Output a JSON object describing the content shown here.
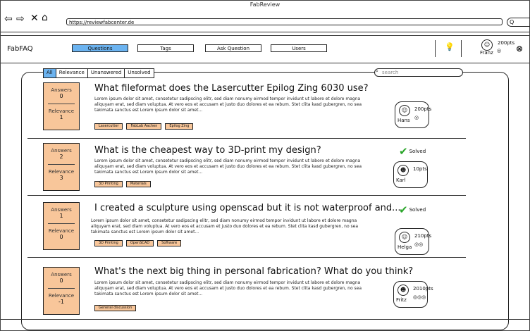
{
  "window": {
    "title": "FabReview"
  },
  "browser": {
    "url": "https://reviewfabcenter.de",
    "search_glyph": "Q"
  },
  "app": {
    "name": "FabFAQ",
    "tabs": [
      "Questions",
      "Tags",
      "Ask Question",
      "Users"
    ],
    "active_tab": "Questions",
    "user": {
      "name": "Franz",
      "points": "200pts",
      "badges": "◎"
    }
  },
  "filters": {
    "options": [
      "All",
      "Relevance",
      "Unanswered",
      "Unsolved"
    ],
    "selected": "All",
    "search_placeholder": "search"
  },
  "labels": {
    "answers": "Answers",
    "relevance": "Relevance",
    "solved": "Solved"
  },
  "questions": [
    {
      "title": "What fileformat does the Lasercutter Epilog Zing 6030 use?",
      "body": "Lorem ipsum dolor sit amet, consetetur sadipscing elitr, sed diam nonumy eirmod tempor invidunt ut labore et dolore magna aliquyam erat, sed diam voluptua. At vero eos et accusam et justo duo dolores et ea rebum. Stet clita kasd gubergren, no sea takimata sanctus est Lorem ipsum dolor sit amet...",
      "answers": "0",
      "relevance": "1",
      "tags": [
        "Lasercutter",
        "FabLab Aachen",
        "Epilog Zing"
      ],
      "solved": false,
      "user": {
        "name": "Hans",
        "points": "200pts",
        "badges": "◎",
        "avatar": "☺"
      }
    },
    {
      "title": "What is the cheapest way to 3D-print my design?",
      "body": "Lorem ipsum dolor sit amet, consetetur sadipscing elitr, sed diam nonumy eirmod tempor invidunt ut labore et dolore magna aliquyam erat, sed diam voluptua. At vero eos et accusam et justo duo dolores et ea rebum. Stet clita kasd gubergren, no sea takimata sanctus est Lorem ipsum dolor sit amet...",
      "answers": "2",
      "relevance": "3",
      "tags": [
        "3D Printing",
        "Materials"
      ],
      "solved": true,
      "user": {
        "name": "Karl",
        "points": "10pts",
        "badges": "",
        "avatar": "☻"
      }
    },
    {
      "title": "I created a sculpture using openscad but it is not waterproof and...",
      "body": "Lorem ipsum dolor sit amet, consetetur sadipscing elitr, sed diam nonumy eirmod tempor invidunt ut labore et dolore magna aliquyam erat, sed diam voluptua. At vero eos et accusam et justo duo dolores et ea rebum. Stet clita kasd gubergren, no sea takimata sanctus est Lorem ipsum dolor sit amet...",
      "answers": "1",
      "relevance": "0",
      "tags": [
        "3D Printing",
        "OpenSCAD",
        "Software"
      ],
      "solved": true,
      "user": {
        "name": "Helga",
        "points": "210pts",
        "badges": "◎◎",
        "avatar": "☺"
      }
    },
    {
      "title": "What's the next big thing in personal fabrication? What do you think?",
      "body": "Lorem ipsum dolor sit amet, consetetur sadipscing elitr, sed diam nonumy eirmod tempor invidunt ut labore et dolore magna aliquyam erat, sed diam voluptua. At vero eos et accusam et justo duo dolores et ea rebum. Stet clita kasd gubergren, no sea takimata sanctus est Lorem ipsum dolor sit amet...",
      "answers": "0",
      "relevance": "-1",
      "tags": [
        "General discussion"
      ],
      "solved": false,
      "user": {
        "name": "Fritz",
        "points": "2010pts",
        "badges": "◎◎◎",
        "avatar": "☻"
      }
    }
  ],
  "colors": {
    "active_blue": "#6bb3f0",
    "orange": "#f8c69a",
    "solved_green": "#2aa52a"
  }
}
